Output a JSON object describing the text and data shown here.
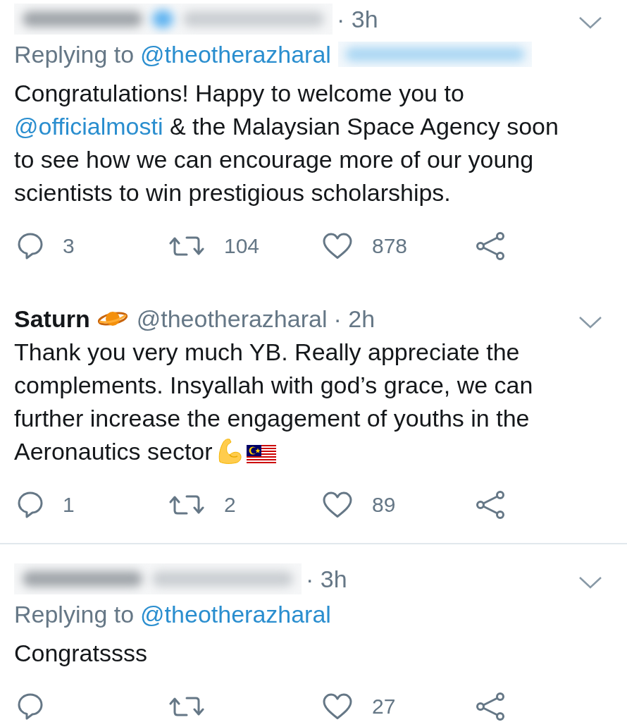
{
  "threads": [
    {
      "tweets": [
        {
          "author": {
            "redacted": true,
            "verified": true
          },
          "time": "· 3h",
          "replying_to": {
            "label": "Replying to",
            "handle": "@theotherazharal",
            "redacted_extra": true
          },
          "body": [
            {
              "kind": "text",
              "text": "Congratulations! Happy to welcome you to "
            },
            {
              "kind": "mention",
              "text": "@officialmosti"
            },
            {
              "kind": "text",
              "text": " & the Malaysian Space Agency soon to see how we can encourage more of our young scientists to win prestigious scholarships."
            }
          ],
          "actions": [
            {
              "kind": "reply",
              "count": "3"
            },
            {
              "kind": "retweet",
              "count": "104"
            },
            {
              "kind": "like",
              "count": "878"
            },
            {
              "kind": "share"
            }
          ]
        },
        {
          "author": {
            "redacted": false,
            "name": "Saturn",
            "name_emoji": [
              {
                "kind": "planet"
              }
            ],
            "handle": "@theotherazharal"
          },
          "time": "· 2h",
          "body": [
            {
              "kind": "text",
              "text": "Thank you very much YB. Really appreciate the complements. Insyallah with god’s grace, we can further increase the engagement of youths in the Aeronautics sector"
            },
            {
              "kind": "flexed-biceps"
            },
            {
              "kind": "flag"
            }
          ],
          "actions": [
            {
              "kind": "reply",
              "count": "1"
            },
            {
              "kind": "retweet",
              "count": "2"
            },
            {
              "kind": "like",
              "count": "89"
            },
            {
              "kind": "share"
            }
          ]
        }
      ]
    },
    {
      "tweets": [
        {
          "author": {
            "redacted": true,
            "verified": false
          },
          "time": "· 3h",
          "replying_to": {
            "label": "Replying to",
            "handle": "@theotherazharal"
          },
          "body": [
            {
              "kind": "text",
              "text": "Congratssss"
            }
          ],
          "actions": [
            {
              "kind": "reply"
            },
            {
              "kind": "retweet"
            },
            {
              "kind": "like",
              "count": "27"
            },
            {
              "kind": "share"
            }
          ]
        }
      ]
    }
  ]
}
